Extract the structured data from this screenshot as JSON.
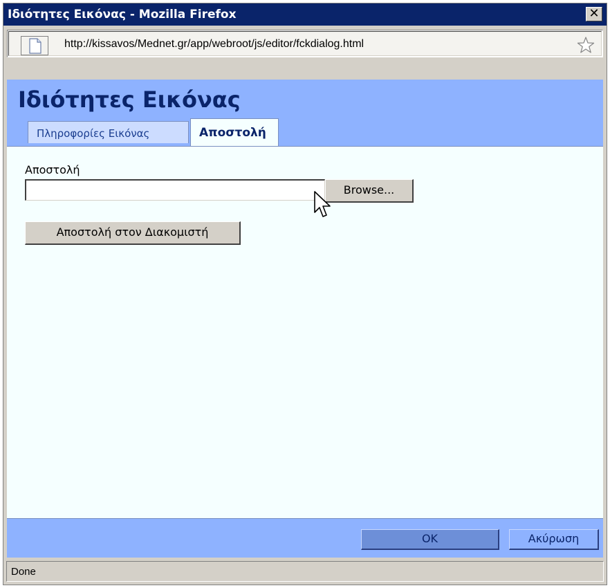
{
  "window": {
    "title": "Ιδιότητες Εικόνας - Mozilla Firefox",
    "close_label": "✕"
  },
  "urlbar": {
    "url": "http://kissavos/Mednet.gr/app/webroot/js/editor/fckdialog.html",
    "page_icon": "page-icon",
    "bookmark_icon": "star-icon"
  },
  "dialog": {
    "title": "Ιδιότητες Εικόνας",
    "tabs": [
      {
        "label": "Πληροφορίες Εικόνας",
        "active": false
      },
      {
        "label": "Αποστολή",
        "active": true
      }
    ],
    "upload_label": "Αποστολή",
    "file_value": "",
    "browse_label": "Browse...",
    "send_label": "Αποστολή στον Διακομιστή",
    "ok_label": "OK",
    "cancel_label": "Ακύρωση"
  },
  "status": {
    "text": "Done"
  },
  "colors": {
    "titlebar": "#0a246a",
    "dialog_header": "#8eb2ff",
    "dialog_body": "#f5ffff"
  }
}
